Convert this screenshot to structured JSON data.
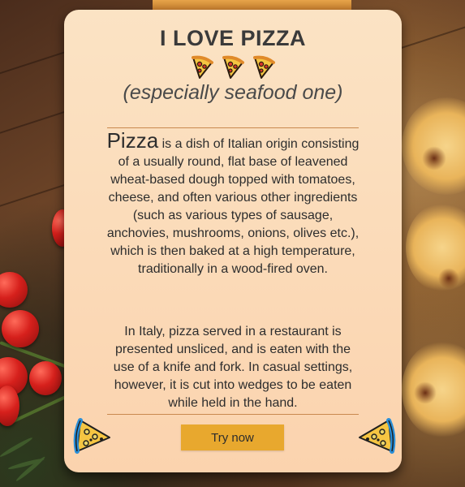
{
  "title": "I LOVE PIZZA",
  "subtitle": "(especially seafood one)",
  "description": {
    "lead_word": "Pizza",
    "text": " is a dish of Italian origin consisting of a usually round, flat base of leavened wheat-based dough topped with tomatoes, cheese, and often various other ingredients (such as various types of sausage, anchovies, mushrooms, onions, olives etc.), which is then baked at a high temperature, traditionally in a wood-fired oven."
  },
  "description2": "In Italy, pizza served in a restaurant is presented unsliced, and is eaten with the use of a knife and fork. In casual settings, however, it is cut into wedges to be eaten while held in the hand.",
  "button": {
    "label": "Try now"
  },
  "icons": {
    "header": [
      "pizza-slice-icon",
      "pizza-slice-icon",
      "pizza-slice-icon"
    ],
    "footer_left": "pizza-slice-icon",
    "footer_right": "pizza-slice-icon"
  },
  "colors": {
    "card_top": "#fbe3c4",
    "card_bottom": "#fbd3ae",
    "button": "#e8a82e",
    "divider": "#c9894f",
    "text": "#2d2d2d"
  }
}
